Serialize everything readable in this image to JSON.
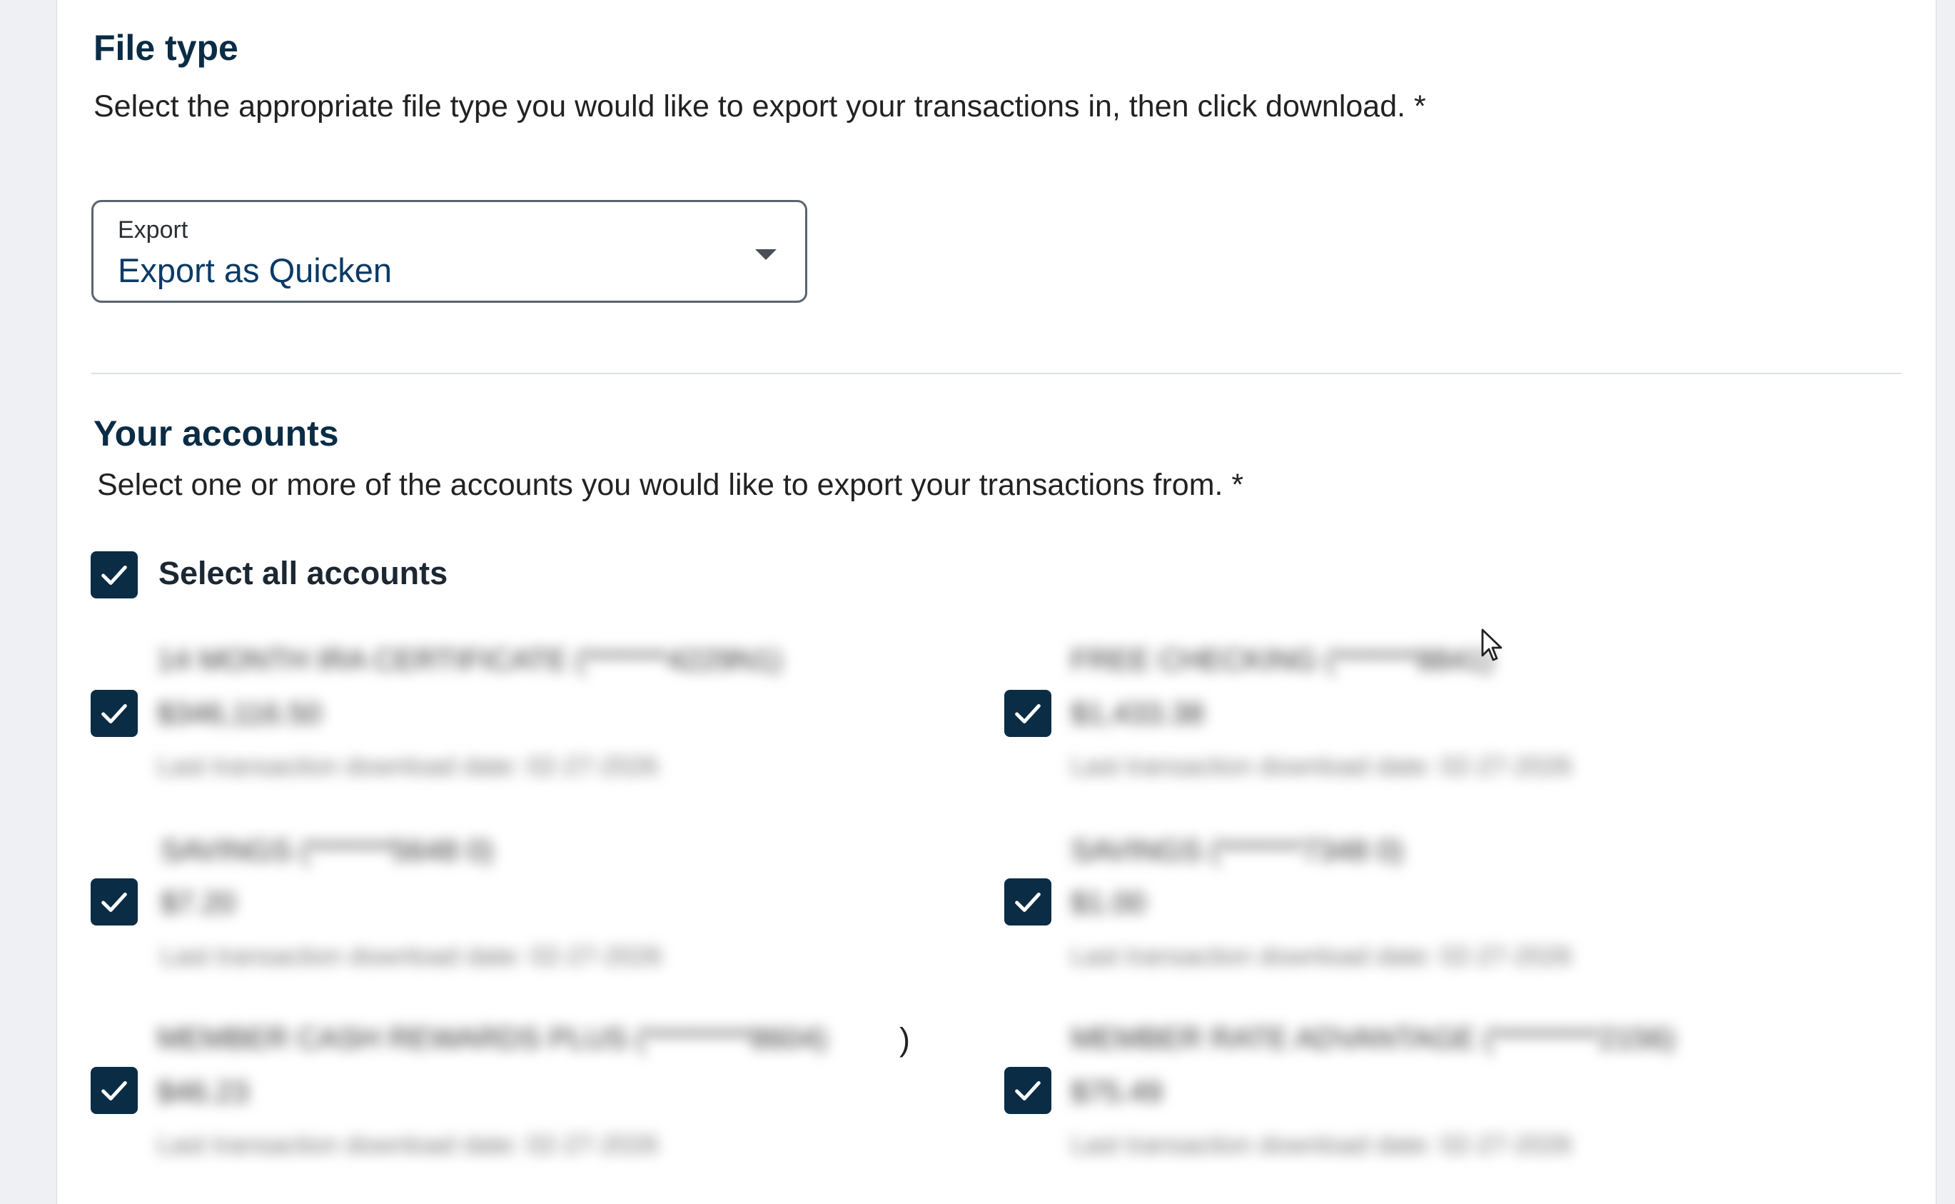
{
  "file_type": {
    "title": "File type",
    "description": "Select the appropriate file type you would like to export your transactions in, then click download. *",
    "export_select": {
      "label": "Export",
      "value": "Export as Quicken",
      "icon": "caret-down-icon"
    }
  },
  "accounts": {
    "title": "Your accounts",
    "description": "Select one or more of the accounts you would like to export your transactions from. *",
    "select_all": {
      "label": "Select all accounts",
      "checked": true
    },
    "items": [
      {
        "name": "14 MONTH IRA CERTIFICATE (*******4229N1)",
        "balance": "$346,116.50",
        "date": "Last transaction download date: 02-27-2026",
        "checked": true
      },
      {
        "name": "FREE CHECKING (*******8841)",
        "balance": "$1,433.38",
        "date": "Last transaction download date: 02-27-2026",
        "checked": true
      },
      {
        "name": "SAVINGS (*******5648 0)",
        "balance": "$7.20",
        "date": "Last transaction download date: 02-27-2026",
        "checked": true
      },
      {
        "name": "SAVINGS (*******7348 0)",
        "balance": "$1.00",
        "date": "Last transaction download date: 02-27-2026",
        "checked": true
      },
      {
        "name": "MEMBER CASH REWARDS PLUS (*********8604)",
        "suffix": ")",
        "balance": "$46.23",
        "date": "Last transaction download date: 02-27-2026",
        "checked": true
      },
      {
        "name": "MEMBER RATE ADVANTAGE (*********2156)",
        "balance": "$75.49",
        "date": "Last transaction download date: 02-27-2026",
        "checked": true
      }
    ]
  },
  "colors": {
    "accent": "#0b2c45",
    "select_value": "#0b3a66",
    "background": "#eef0f3"
  }
}
